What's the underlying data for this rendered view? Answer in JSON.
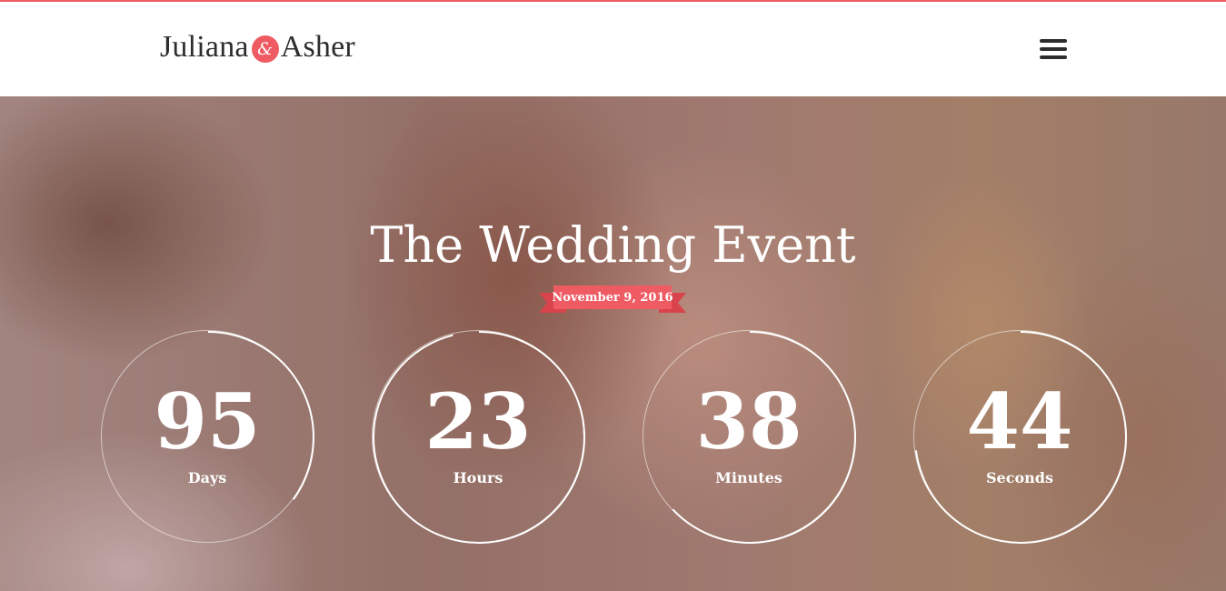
{
  "header": {
    "logo_first": "Juliana",
    "logo_amp": "&",
    "logo_second": "Asher",
    "menu_icon": "hamburger-menu-icon"
  },
  "hero": {
    "title": "The Wedding Event",
    "date": "November 9, 2016"
  },
  "countdown": [
    {
      "value": "95",
      "label": "Days",
      "progress": 0.35
    },
    {
      "value": "23",
      "label": "Hours",
      "progress": 0.96
    },
    {
      "value": "38",
      "label": "Minutes",
      "progress": 0.63
    },
    {
      "value": "44",
      "label": "Seconds",
      "progress": 0.73
    }
  ],
  "colors": {
    "accent": "#ef5b63",
    "text_dark": "#2d2d2d",
    "white": "#ffffff"
  }
}
